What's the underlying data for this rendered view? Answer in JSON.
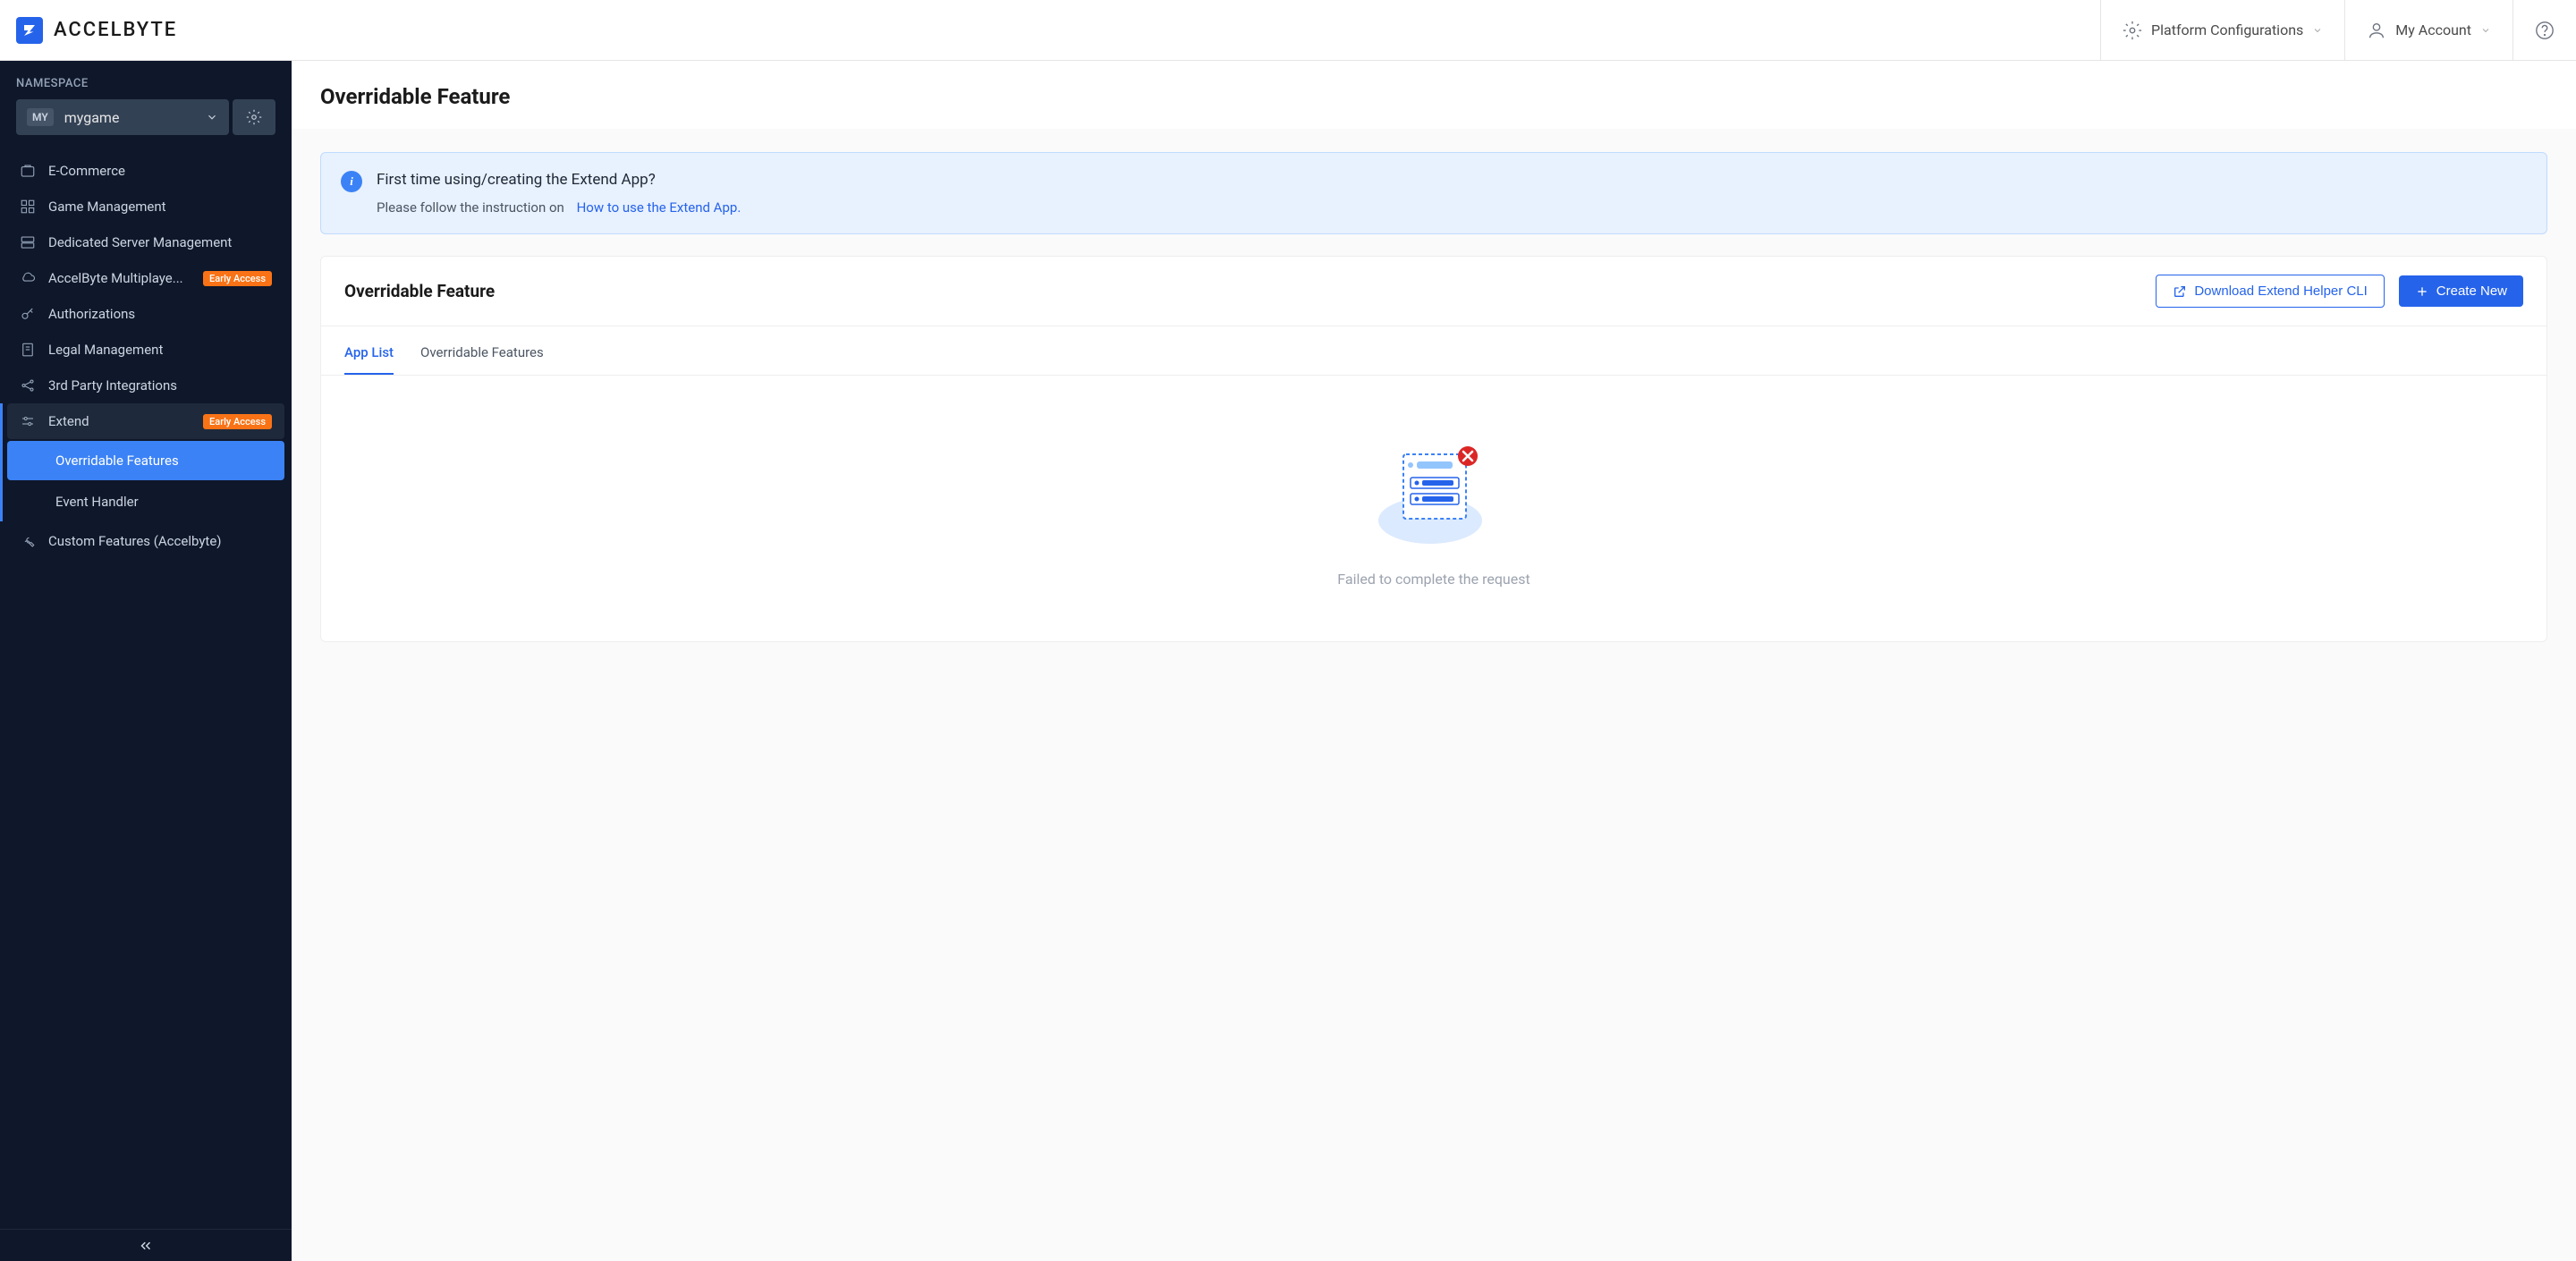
{
  "brand": "ACCELBYTE",
  "header": {
    "platform_config": "Platform Configurations",
    "my_account": "My Account"
  },
  "sidebar": {
    "namespace_label": "NAMESPACE",
    "namespace_badge": "MY",
    "namespace_name": "mygame",
    "items": [
      {
        "label": "E-Commerce",
        "icon": "cart"
      },
      {
        "label": "Game Management",
        "icon": "grid"
      },
      {
        "label": "Dedicated Server Management",
        "icon": "server"
      },
      {
        "label": "AccelByte Multiplaye...",
        "icon": "cloud",
        "badge": "Early Access"
      },
      {
        "label": "Authorizations",
        "icon": "key"
      },
      {
        "label": "Legal Management",
        "icon": "doc"
      },
      {
        "label": "3rd Party Integrations",
        "icon": "share"
      },
      {
        "label": "Extend",
        "icon": "sliders",
        "badge": "Early Access",
        "expanded": true
      },
      {
        "label": "Custom Features (Accelbyte)",
        "icon": "wrench"
      }
    ],
    "extend_sub": [
      {
        "label": "Overridable Features",
        "active": true
      },
      {
        "label": "Event Handler",
        "active": false
      }
    ]
  },
  "page": {
    "title": "Overridable Feature",
    "banner_title": "First time using/creating the Extend App?",
    "banner_sub": "Please follow the instruction on",
    "banner_link": "How to use the Extend App.",
    "panel_title": "Overridable Feature",
    "download_cli": "Download Extend Helper CLI",
    "create_new": "Create New",
    "tabs": [
      {
        "label": "App List",
        "active": true
      },
      {
        "label": "Overridable Features",
        "active": false
      }
    ],
    "empty_message": "Failed to complete the request"
  }
}
